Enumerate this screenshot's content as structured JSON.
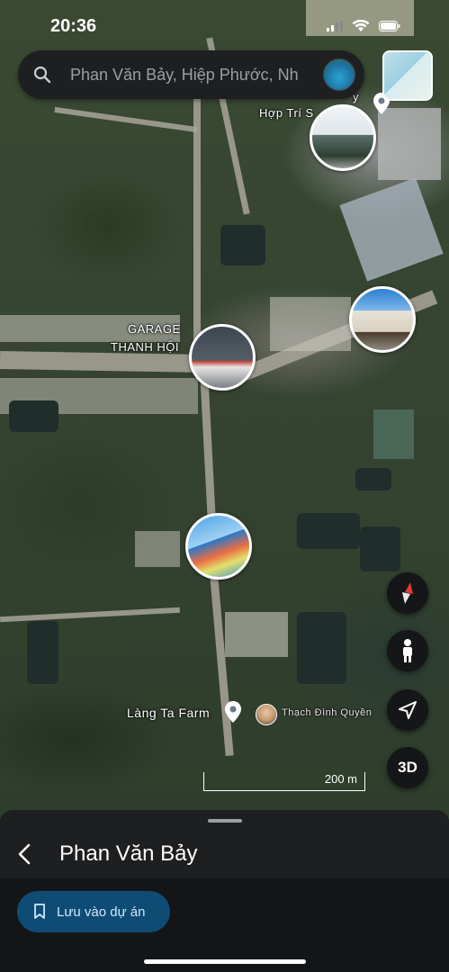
{
  "status_bar": {
    "time": "20:36"
  },
  "search": {
    "value": "Phan Văn Bảy, Hiệp Phước, Nh"
  },
  "map_labels": {
    "hop_tri": "Hợp Trí S",
    "hop_tri_top": "y",
    "garage_line1": "GARAGE",
    "garage_line2": "THANH HỘI",
    "lang_ta_farm": "Làng Ta Farm",
    "contributor": "Thạch Đình Quyền"
  },
  "scale": {
    "label": "200 m"
  },
  "controls": {
    "btn_3d": "3D"
  },
  "sheet": {
    "title": "Phan Văn Bảy",
    "save_label": "Lưu vào dự án"
  },
  "icons": [
    "search-icon",
    "compass-icon",
    "pegman-icon",
    "location-arrow-icon",
    "back-chevron-icon",
    "bookmark-icon",
    "signal-icon",
    "wifi-icon",
    "battery-icon"
  ],
  "colors": {
    "accent_button": "#0f4c75",
    "sheet_bg": "#1e1f21"
  }
}
